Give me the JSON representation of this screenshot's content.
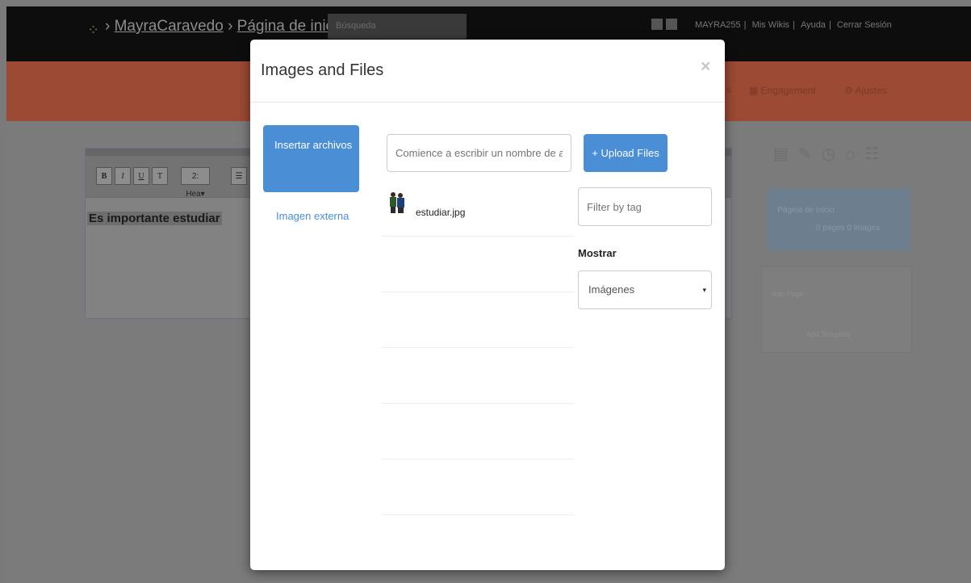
{
  "background": {
    "breadcrumb": {
      "site": "MayraCaravedo",
      "separator": "›",
      "page": "Página de inicio"
    },
    "search_placeholder": "Búsqueda",
    "user_links": [
      "MAYRA255",
      "Mis Wikis",
      "Ayuda",
      "Cerrar Sesión"
    ],
    "nav_links": [
      "Engagement",
      "Ajustes"
    ],
    "editor": {
      "toolbar": {
        "bold": "B",
        "italic": "I",
        "underline": "U",
        "heading": "2: Hea▾"
      },
      "content": "Es importante estudiar"
    },
    "right_panel": {
      "blue_line1": "Página de inicio",
      "blue_line2": "0 pages   0 images",
      "box_line1": "Add Page",
      "box_line2": "Add Template"
    }
  },
  "modal": {
    "title": "Images and Files",
    "close": "×",
    "nav": {
      "active": "Insertar archivos",
      "link": "Imagen externa"
    },
    "search_placeholder": "Comience a escribir un nombre de ar",
    "upload_label": "+ Upload Files",
    "files": [
      {
        "name": "estudiar.jpg",
        "thumb_icon": "students-image-icon"
      }
    ],
    "tag_placeholder": "Filter by tag",
    "show_label": "Mostrar",
    "show_select": {
      "value": "Imágenes",
      "caret": "▾"
    }
  }
}
